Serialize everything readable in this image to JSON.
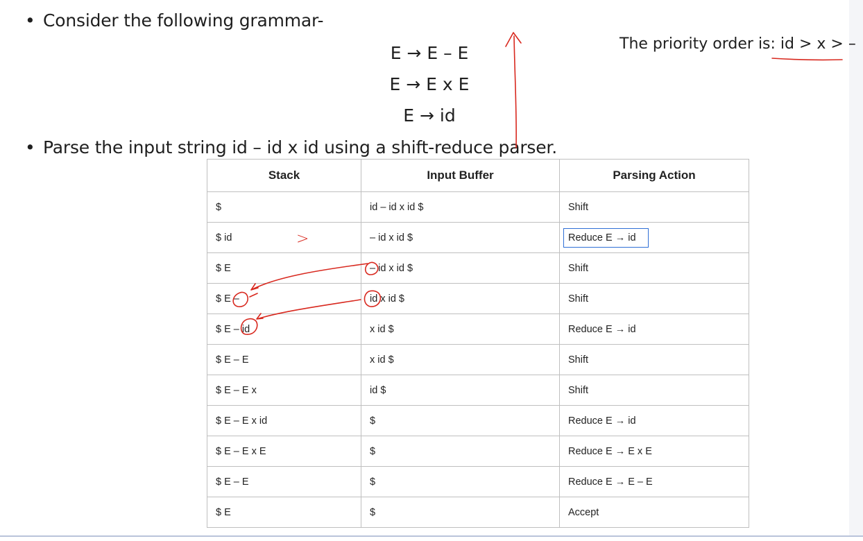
{
  "bullets": {
    "grammar_intro": "Consider the following grammar-",
    "parse_instruction": "Parse the input string id – id x id using a shift-reduce parser."
  },
  "grammar": {
    "rules": [
      "E → E – E",
      "E → E x E",
      "E → id"
    ]
  },
  "priority_note": "The priority order is: id > x > –",
  "table": {
    "headers": [
      "Stack",
      "Input Buffer",
      "Parsing Action"
    ],
    "rows": [
      [
        "$",
        "id – id x id $",
        "Shift"
      ],
      [
        "$ id",
        "– id x id $",
        "Reduce E → id"
      ],
      [
        "$ E",
        "– id x id $",
        "Shift"
      ],
      [
        "$ E –",
        "id x id $",
        "Shift"
      ],
      [
        "$ E – id",
        "x id $",
        "Reduce E → id"
      ],
      [
        "$ E – E",
        "x id $",
        "Shift"
      ],
      [
        "$ E – E x",
        "id $",
        "Shift"
      ],
      [
        "$ E – E x id",
        "$",
        "Reduce E → id"
      ],
      [
        "$ E – E x E",
        "$",
        "Reduce E → E x E"
      ],
      [
        "$ E – E",
        "$",
        "Reduce E → E – E"
      ],
      [
        "$ E",
        "$",
        "Accept"
      ]
    ]
  },
  "annotations": {
    "ink_color": "#d8281e",
    "greater_than_mark": ">",
    "highlight_color": "#2f6fd6"
  }
}
